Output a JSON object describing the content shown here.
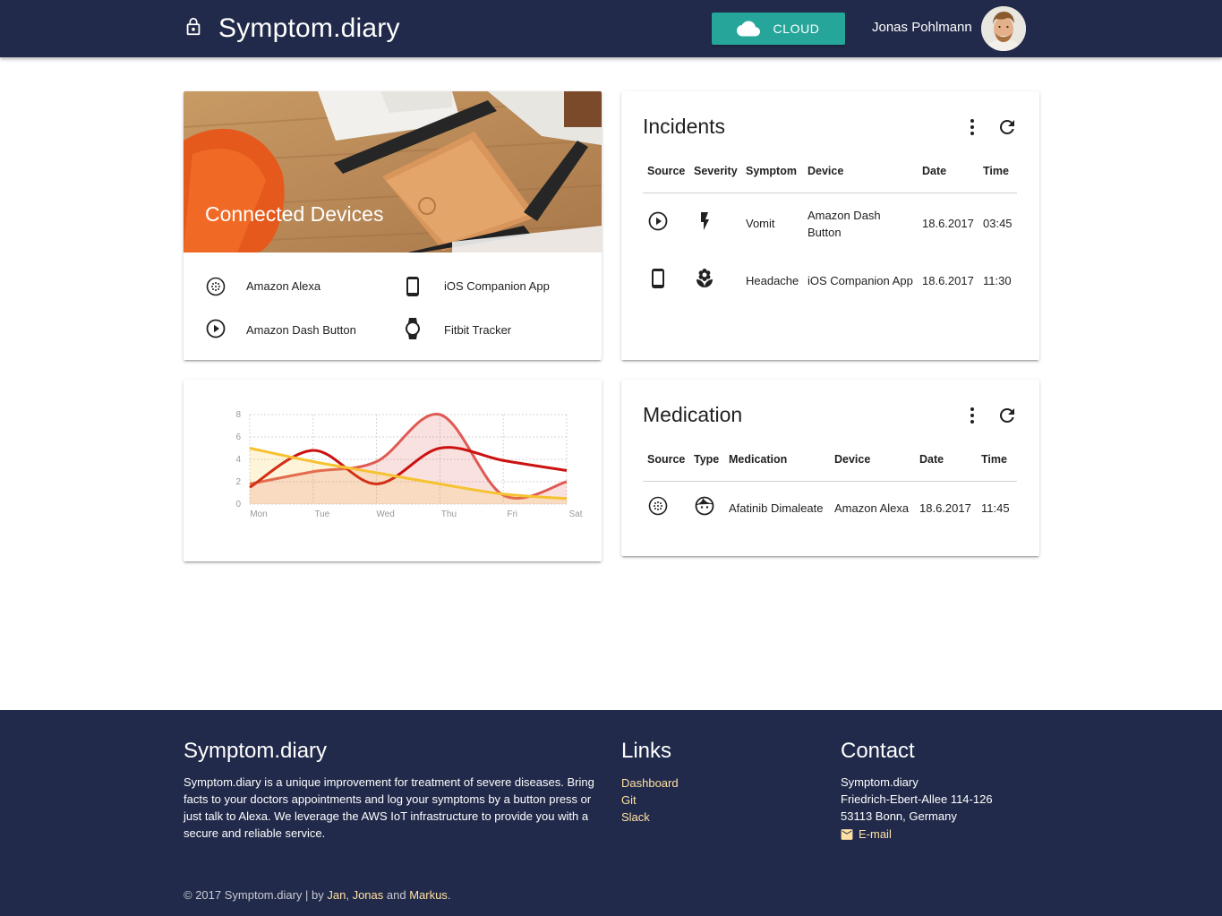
{
  "header": {
    "title": "Symptom.diary",
    "cloud_label": "CLOUD",
    "user_name": "Jonas Pohlmann"
  },
  "devices_card": {
    "title": "Connected Devices",
    "items": [
      {
        "label": "Amazon Alexa",
        "icon": "alexa-dots-icon"
      },
      {
        "label": "iOS Companion App",
        "icon": "smartphone-icon"
      },
      {
        "label": "Amazon Dash Button",
        "icon": "play-circle-icon"
      },
      {
        "label": "Fitbit Tracker",
        "icon": "watch-icon"
      }
    ]
  },
  "incidents": {
    "title": "Incidents",
    "headers": [
      "Source",
      "Severity",
      "Symptom",
      "Device",
      "Date",
      "Time"
    ],
    "rows": [
      {
        "source_icon": "play-circle-icon",
        "severity_icon": "lightning-icon",
        "symptom": "Vomit",
        "device": "Amazon Dash Button",
        "date": "18.6.2017",
        "time": "03:45"
      },
      {
        "source_icon": "smartphone-icon",
        "severity_icon": "local-florist-icon",
        "symptom": "Headache",
        "device": "iOS Companion App",
        "date": "18.6.2017",
        "time": "11:30"
      }
    ]
  },
  "medication": {
    "title": "Medication",
    "headers": [
      "Source",
      "Type",
      "Medication",
      "Device",
      "Date",
      "Time"
    ],
    "rows": [
      {
        "source_icon": "alexa-dots-icon",
        "type_icon": "face-icon",
        "medication": "Afatinib Dimaleate",
        "device": "Amazon Alexa",
        "date": "18.6.2017",
        "time": "11:45"
      }
    ]
  },
  "chart_data": {
    "type": "line",
    "categories": [
      "Mon",
      "Tue",
      "Wed",
      "Thu",
      "Fri",
      "Sat"
    ],
    "ylim": [
      0,
      8
    ],
    "yticks": [
      0,
      2,
      4,
      6,
      8
    ],
    "series": [
      {
        "values": [
          1.8,
          2.9,
          3.8,
          8.0,
          0.8,
          2.0
        ],
        "color": "#e05a55",
        "fill": true
      },
      {
        "values": [
          1.5,
          4.8,
          1.8,
          5.0,
          3.9,
          3.0
        ],
        "color": "#cc1111",
        "fill": false
      },
      {
        "values": [
          5.0,
          3.8,
          2.8,
          1.8,
          0.9,
          0.5
        ],
        "color": "#f6c230",
        "fill": true
      }
    ]
  },
  "footer": {
    "title": "Symptom.diary",
    "description": "Symptom.diary is a unique improvement for treatment of severe diseases. Bring facts to your doctors appointments and log your symptoms by a button press or just talk to Alexa. We leverage the AWS IoT infrastructure to provide you with a secure and reliable service.",
    "links_title": "Links",
    "links": [
      "Dashboard",
      "Git",
      "Slack"
    ],
    "contact_title": "Contact",
    "contact_lines": [
      "Symptom.diary",
      "Friedrich-Ebert-Allee 114-126",
      "53113 Bonn, Germany"
    ],
    "email_label": "E-mail",
    "copyright_prefix": "© 2017 Symptom.diary | by ",
    "authors": [
      "Jan",
      "Jonas",
      "Markus"
    ],
    "sep1": ", ",
    "sep2": " and ",
    "end": "."
  },
  "colors": {
    "navbar": "#212a4a",
    "accent": "#26a69a",
    "footer_link": "#ffe0a3"
  }
}
